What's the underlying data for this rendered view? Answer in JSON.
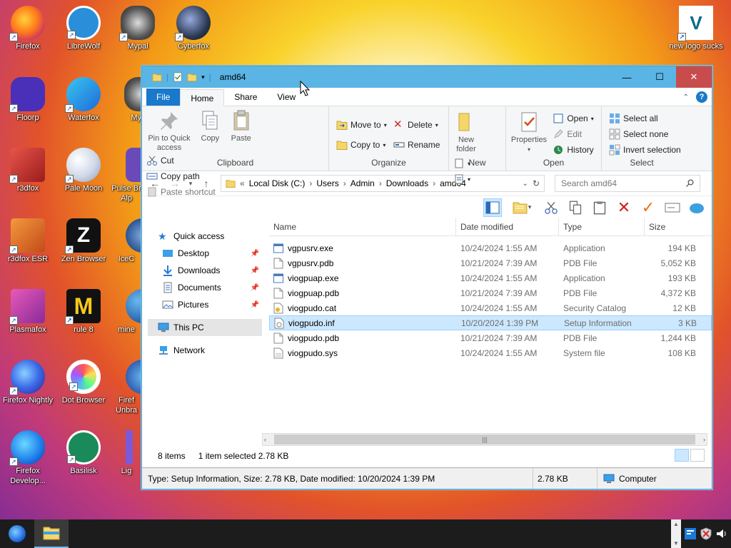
{
  "desktop": {
    "icons": [
      {
        "label": "Firefox"
      },
      {
        "label": "LibreWolf"
      },
      {
        "label": "Mypal"
      },
      {
        "label": "Cyberfox"
      },
      {
        "label": "Floorp"
      },
      {
        "label": "Waterfox"
      },
      {
        "label": "My"
      },
      {
        "label": "r3dfox"
      },
      {
        "label": "Pale Moon"
      },
      {
        "label": "Pulse Br Alp"
      },
      {
        "label": "r3dfox ESR"
      },
      {
        "label": "Zen Browser"
      },
      {
        "label": "IceC"
      },
      {
        "label": "Plasmafox"
      },
      {
        "label": "rule 8"
      },
      {
        "label": "mine"
      },
      {
        "label": "Firefox Nightly"
      },
      {
        "label": "Dot Browser"
      },
      {
        "label": "Firef Unbra"
      },
      {
        "label": "Firefox Develop..."
      },
      {
        "label": "Basilisk"
      },
      {
        "label": "Lig"
      },
      {
        "label": "new logo sucks"
      }
    ]
  },
  "window": {
    "title": "amd64",
    "tabs": [
      "File",
      "Home",
      "Share",
      "View"
    ],
    "controls": {
      "minimize": "—",
      "maximize": "☐",
      "close": "✕"
    }
  },
  "ribbon": {
    "clipboard": {
      "label": "Clipboard",
      "pin": "Pin to Quick access",
      "copy": "Copy",
      "paste": "Paste",
      "cut": "Cut",
      "copy_path": "Copy path",
      "paste_shortcut": "Paste shortcut"
    },
    "organize": {
      "label": "Organize",
      "move_to": "Move to",
      "copy_to": "Copy to",
      "delete": "Delete",
      "rename": "Rename"
    },
    "new": {
      "label": "New",
      "new_folder": "New folder"
    },
    "open": {
      "label": "Open",
      "properties": "Properties",
      "open": "Open",
      "edit": "Edit",
      "history": "History"
    },
    "select": {
      "label": "Select",
      "select_all": "Select all",
      "select_none": "Select none",
      "invert": "Invert selection"
    }
  },
  "address": {
    "prefix": "«",
    "crumbs": [
      "Local Disk (C:)",
      "Users",
      "Admin",
      "Downloads",
      "amd64"
    ],
    "search_placeholder": "Search amd64"
  },
  "nav": {
    "items": [
      {
        "label": "Quick access"
      },
      {
        "label": "Desktop"
      },
      {
        "label": "Downloads"
      },
      {
        "label": "Documents"
      },
      {
        "label": "Pictures"
      },
      {
        "label": "This PC"
      },
      {
        "label": "Network"
      }
    ]
  },
  "files": {
    "columns": [
      "Name",
      "Date modified",
      "Type",
      "Size"
    ],
    "rows": [
      {
        "name": "vgpusrv.exe",
        "date": "10/24/2024 1:55 AM",
        "type": "Application",
        "size": "194 KB",
        "kind": "exe"
      },
      {
        "name": "vgpusrv.pdb",
        "date": "10/21/2024 7:39 AM",
        "type": "PDB File",
        "size": "5,052 KB",
        "kind": "file"
      },
      {
        "name": "viogpuap.exe",
        "date": "10/24/2024 1:55 AM",
        "type": "Application",
        "size": "193 KB",
        "kind": "exe"
      },
      {
        "name": "viogpuap.pdb",
        "date": "10/21/2024 7:39 AM",
        "type": "PDB File",
        "size": "4,372 KB",
        "kind": "file"
      },
      {
        "name": "viogpudo.cat",
        "date": "10/24/2024 1:55 AM",
        "type": "Security Catalog",
        "size": "12 KB",
        "kind": "cat"
      },
      {
        "name": "viogpudo.inf",
        "date": "10/20/2024 1:39 PM",
        "type": "Setup Information",
        "size": "3 KB",
        "kind": "inf"
      },
      {
        "name": "viogpudo.pdb",
        "date": "10/21/2024 7:39 AM",
        "type": "PDB File",
        "size": "1,244 KB",
        "kind": "file"
      },
      {
        "name": "viogpudo.sys",
        "date": "10/24/2024 1:55 AM",
        "type": "System file",
        "size": "108 KB",
        "kind": "sys"
      }
    ]
  },
  "status": {
    "count": "8 items",
    "selection": "1 item selected  2.78 KB"
  },
  "details_bar": {
    "info": "Type: Setup Information, Size: 2.78 KB, Date modified: 10/20/2024 1:39 PM",
    "size": "2.78 KB",
    "location": "Computer"
  }
}
